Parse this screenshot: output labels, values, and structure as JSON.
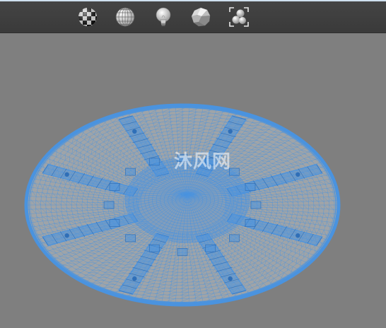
{
  "toolbar": {
    "buttons": [
      {
        "icon": "checker-sphere-icon",
        "name": "texture-mode-button"
      },
      {
        "icon": "wireframe-sphere-icon",
        "name": "wireframe-mode-button"
      },
      {
        "icon": "light-bulb-icon",
        "name": "lighting-button"
      },
      {
        "icon": "faceted-sphere-icon",
        "name": "shaded-mode-button"
      },
      {
        "icon": "fit-view-spheres-icon",
        "name": "fit-view-button"
      }
    ]
  },
  "viewport": {
    "model": "wireframe-mesh",
    "mesh_color": "#4a93df",
    "background": "#7f7f7f"
  },
  "watermark": {
    "text": "沐风网"
  }
}
